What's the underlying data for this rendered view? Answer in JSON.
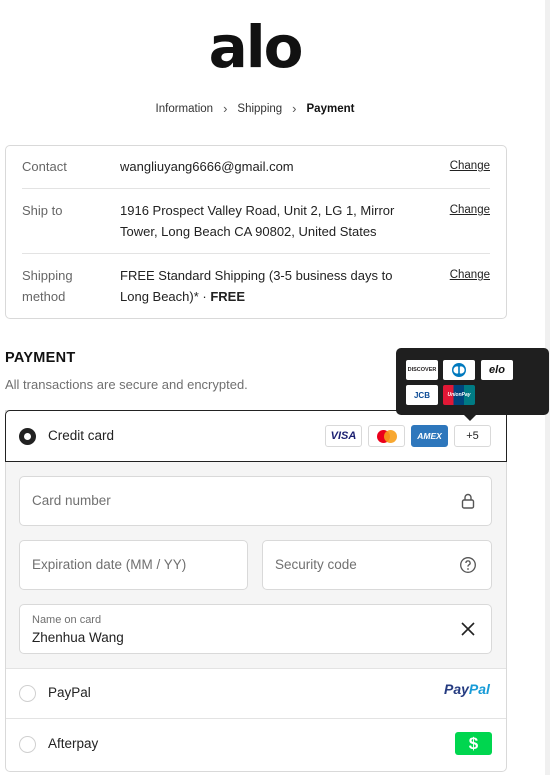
{
  "brand": {
    "logo_text": "alo"
  },
  "breadcrumb": {
    "items": [
      "Information",
      "Shipping",
      "Payment"
    ],
    "separator": "›"
  },
  "review": {
    "contact": {
      "label": "Contact",
      "value": "wangliuyang6666@gmail.com",
      "action": "Change"
    },
    "ship_to": {
      "label": "Ship to",
      "value_line1": "1916 Prospect Valley Road, Unit 2, LG 1, Mirror",
      "value_line2": "Tower, Long Beach CA 90802, United States",
      "action": "Change"
    },
    "shipping_method": {
      "label_line1": "Shipping",
      "label_line2": "method",
      "value_line1": "FREE Standard Shipping (3-5 business days to",
      "value_line2": "Long Beach)* · ",
      "value_bold": "FREE",
      "action": "Change"
    }
  },
  "payment": {
    "title": "PAYMENT",
    "subtitle": "All transactions are secure and encrypted.",
    "credit_card": {
      "label": "Credit card",
      "selected": true,
      "card_logos": [
        "VISA",
        "AMEX"
      ],
      "more_label": "+5",
      "card_number_placeholder": "Card number",
      "expiration_placeholder": "Expiration date (MM / YY)",
      "security_code_placeholder": "Security code",
      "name_on_card_label": "Name on card",
      "name_on_card_value": "Zhenhua Wang"
    },
    "tooltip_cards": [
      "DISCOVER",
      "elo",
      "JCB",
      "UnionPay"
    ],
    "paypal": {
      "label": "PayPal",
      "logo_text_a": "Pay",
      "logo_text_b": "Pal"
    },
    "afterpay": {
      "label": "Afterpay",
      "logo_glyph": "$"
    }
  },
  "colors": {
    "paypal_dark": "#253b80",
    "paypal_light": "#179bd7",
    "afterpay_green": "#00d64f",
    "amex_blue": "#2e77bc",
    "visa_blue": "#1a1f71"
  },
  "icons": [
    "lock-icon",
    "help-circle-icon",
    "close-icon",
    "chevron-right-icon",
    "radio-icon"
  ]
}
